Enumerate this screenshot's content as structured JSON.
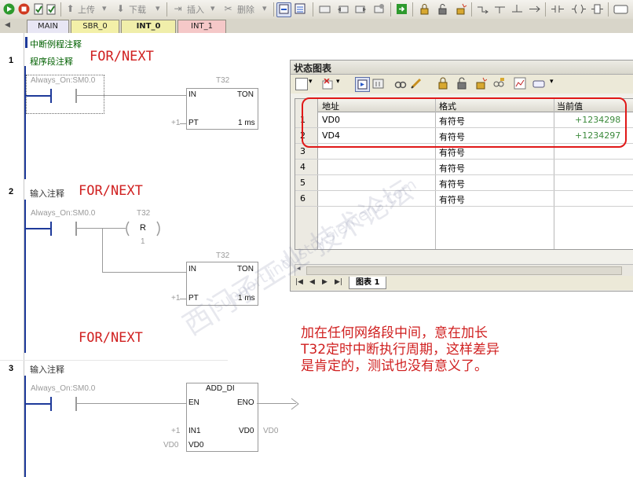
{
  "toolbar": {
    "upload_label": "上传",
    "download_label": "下载",
    "insert_label": "插入",
    "delete_label": "删除"
  },
  "tabs": [
    {
      "label": "MAIN",
      "color": "#e8e6f4"
    },
    {
      "label": "SBR_0",
      "color": "#f3f0a8"
    },
    {
      "label": "INT_0",
      "color": "#f0eeaa"
    },
    {
      "label": "INT_1",
      "color": "#f5c8c8"
    }
  ],
  "editor": {
    "routine_comment": "中断例程注释",
    "networks": [
      {
        "number": "1",
        "comment": "程序段注释",
        "overlay": "FOR/NEXT",
        "contact_label": "Always_On:SM0.0",
        "timer_label": "T32",
        "block": {
          "name": "TON",
          "in": "IN",
          "pt": "PT",
          "pt_value": "+1",
          "unit": "1 ms"
        }
      },
      {
        "number": "2",
        "comment": "输入注释",
        "overlay": "FOR/NEXT",
        "contact_label": "Always_On:SM0.0",
        "coil_label": "T32",
        "coil_letter": "R",
        "coil_value": "1",
        "timer_label": "T32",
        "block": {
          "name": "TON",
          "in": "IN",
          "pt": "PT",
          "pt_value": "+1",
          "unit": "1 ms"
        }
      },
      {
        "overlay_between": "FOR/NEXT"
      },
      {
        "number": "3",
        "comment": "输入注释",
        "contact_label": "Always_On:SM0.0",
        "block": {
          "name": "ADD_DI",
          "en": "EN",
          "eno": "ENO",
          "in1": "IN1",
          "in1_value": "+1",
          "in2": "VD0",
          "in2_value": "VD0",
          "out": "VD0",
          "out_value": "VD0"
        }
      }
    ]
  },
  "status_table": {
    "title": "状态图表",
    "headers": [
      "地址",
      "格式",
      "当前值"
    ],
    "rows": [
      {
        "num": "1",
        "address": "VD0",
        "format": "有符号",
        "value": "+1234298"
      },
      {
        "num": "2",
        "address": "VD4",
        "format": "有符号",
        "value": "+1234297"
      },
      {
        "num": "3",
        "address": "",
        "format": "有符号",
        "value": ""
      },
      {
        "num": "4",
        "address": "",
        "format": "有符号",
        "value": ""
      },
      {
        "num": "5",
        "address": "",
        "format": "有符号",
        "value": ""
      },
      {
        "num": "6",
        "address": "",
        "format": "有符号",
        "value": ""
      }
    ],
    "sheet_tab": "图表 1"
  },
  "annotation": {
    "lines": [
      "加在任何网络段中间，意在加长",
      "T32定时中断执行周期，这样差异",
      "是肯定的，测试也没有意义了。"
    ]
  },
  "watermark": {
    "line1": "西门子工业 技术论坛",
    "line2": "support.industry.siemens.com"
  }
}
